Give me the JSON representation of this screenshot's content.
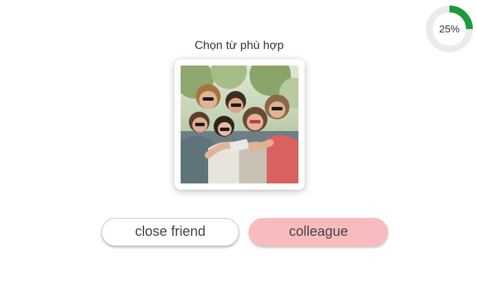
{
  "progress": {
    "label": "25%",
    "fraction": 0.25,
    "fill_color": "#1f9a3a",
    "track_color": "#e9ebf1"
  },
  "question": {
    "prompt": "Chọn từ phù hợp"
  },
  "answers": [
    {
      "label": "close friend",
      "state": "default"
    },
    {
      "label": "colleague",
      "state": "selected",
      "color": "#f9bcbe"
    }
  ]
}
